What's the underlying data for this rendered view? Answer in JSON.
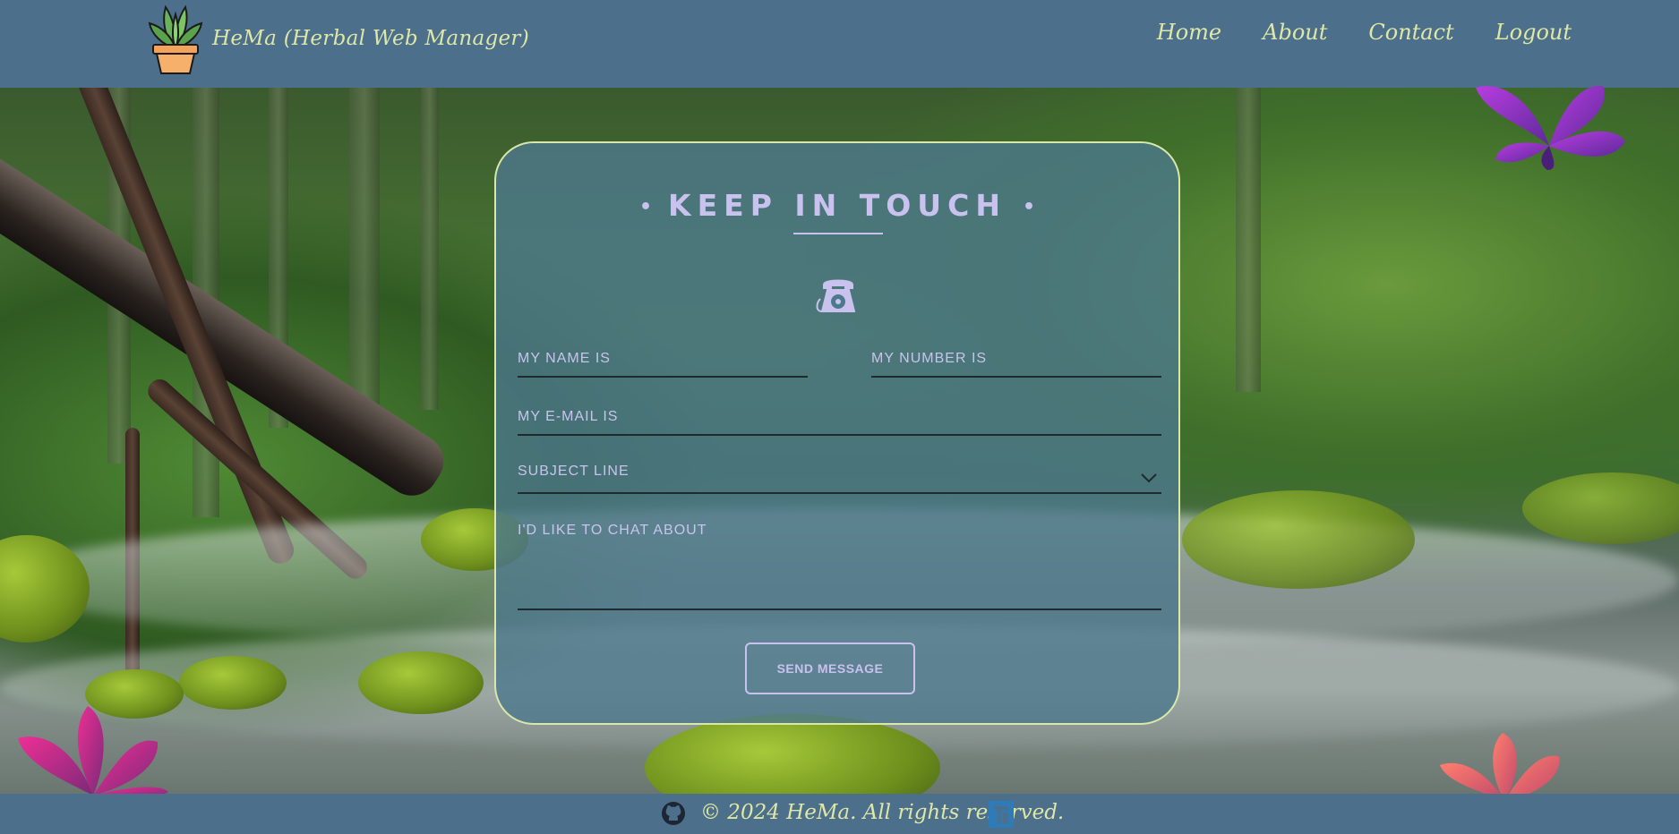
{
  "app": {
    "brand_title": "HeMa (Herbal Web Manager)"
  },
  "nav": {
    "items": [
      {
        "label": "Home"
      },
      {
        "label": "About"
      },
      {
        "label": "Contact"
      },
      {
        "label": "Logout"
      }
    ]
  },
  "contact_form": {
    "title": "KEEP IN TOUCH",
    "title_dot": "•",
    "icon": "telephone-icon",
    "name_placeholder": "MY NAME IS",
    "number_placeholder": "MY NUMBER IS",
    "email_placeholder": "MY E-MAIL IS",
    "subject_placeholder": "SUBJECT LINE",
    "message_placeholder": "I'D LIKE TO CHAT ABOUT",
    "send_label": "SEND MESSAGE"
  },
  "footer": {
    "copyright": "© 2024 HeMa. All rights reserved."
  },
  "colors": {
    "header_bg": "#4c6f8c",
    "accent_text": "#dfe7a6",
    "card_text": "#c9c2ef",
    "card_border": "#d9e8a8"
  }
}
